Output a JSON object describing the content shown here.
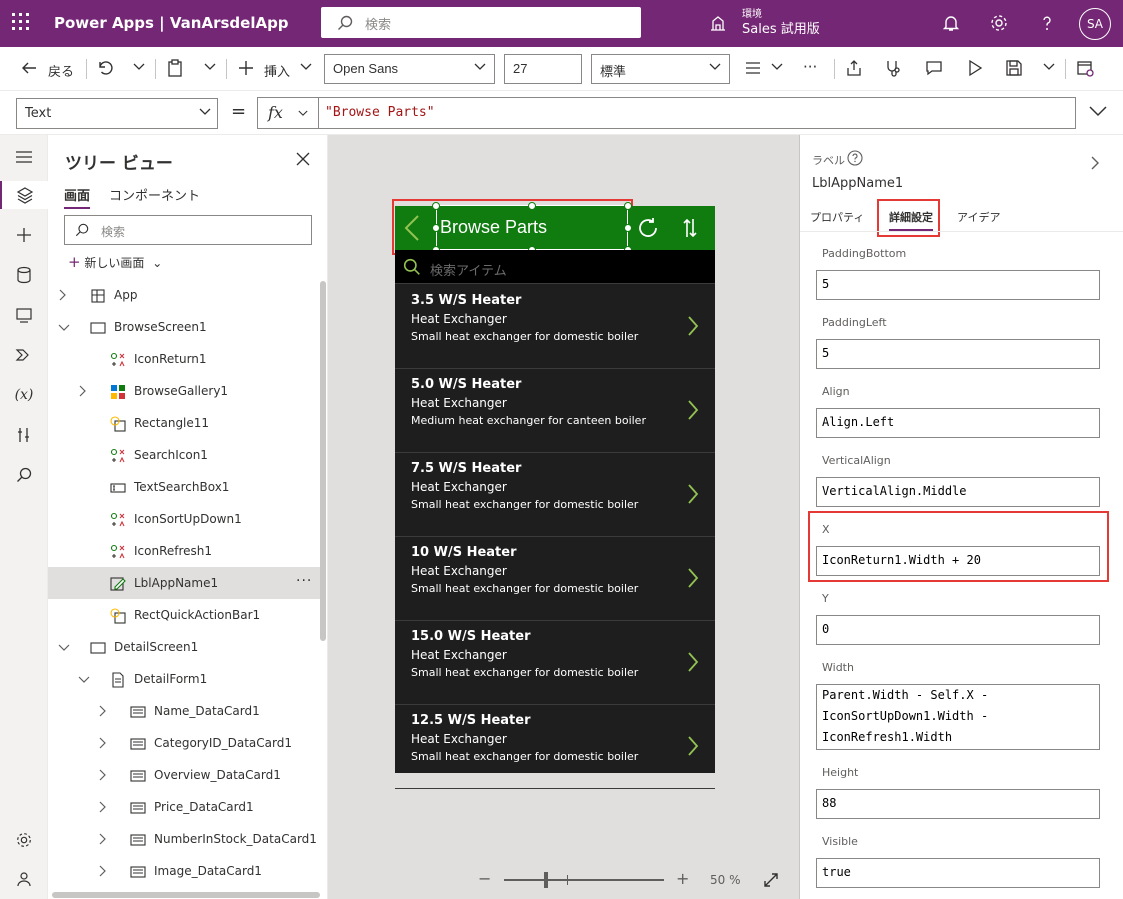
{
  "header": {
    "brand": "Power Apps | VanArsdelApp",
    "search_placeholder": "検索",
    "env_label": "環境",
    "env_name": "Sales 試用版",
    "avatar": "SA"
  },
  "command_bar": {
    "back": "戻る",
    "insert": "挿入",
    "font": "Open Sans",
    "font_size": "27",
    "font_weight": "標準",
    "more": "···"
  },
  "formula_bar": {
    "property": "Text",
    "equals": "=",
    "fx": "fx",
    "formula": "\"Browse Parts\""
  },
  "tree": {
    "title": "ツリー ビュー",
    "tabs": [
      "画面",
      "コンポーネント"
    ],
    "search_placeholder": "検索",
    "new_screen": "新しい画面",
    "rows": [
      {
        "label": "App",
        "indent": 0,
        "icon": "app-icon",
        "chevron": "right",
        "selected": false
      },
      {
        "label": "BrowseScreen1",
        "indent": 0,
        "icon": "screen-icon",
        "chevron": "down",
        "selected": false
      },
      {
        "label": "IconReturn1",
        "indent": 1,
        "icon": "icon-control-icon",
        "chevron": "",
        "selected": false
      },
      {
        "label": "BrowseGallery1",
        "indent": 1,
        "icon": "gallery-icon",
        "chevron": "right",
        "selected": false
      },
      {
        "label": "Rectangle11",
        "indent": 1,
        "icon": "shape-icon",
        "chevron": "",
        "selected": false
      },
      {
        "label": "SearchIcon1",
        "indent": 1,
        "icon": "icon-control-icon",
        "chevron": "",
        "selected": false
      },
      {
        "label": "TextSearchBox1",
        "indent": 1,
        "icon": "textinput-icon",
        "chevron": "",
        "selected": false
      },
      {
        "label": "IconSortUpDown1",
        "indent": 1,
        "icon": "icon-control-icon",
        "chevron": "",
        "selected": false
      },
      {
        "label": "IconRefresh1",
        "indent": 1,
        "icon": "icon-control-icon",
        "chevron": "",
        "selected": false
      },
      {
        "label": "LblAppName1",
        "indent": 1,
        "icon": "label-icon",
        "chevron": "",
        "selected": true
      },
      {
        "label": "RectQuickActionBar1",
        "indent": 1,
        "icon": "shape-icon",
        "chevron": "",
        "selected": false
      },
      {
        "label": "DetailScreen1",
        "indent": 0,
        "icon": "screen-icon",
        "chevron": "down",
        "selected": false
      },
      {
        "label": "DetailForm1",
        "indent": 1,
        "icon": "form-icon",
        "chevron": "down",
        "selected": false
      },
      {
        "label": "Name_DataCard1",
        "indent": 2,
        "icon": "datacard-icon",
        "chevron": "right",
        "selected": false
      },
      {
        "label": "CategoryID_DataCard1",
        "indent": 2,
        "icon": "datacard-icon",
        "chevron": "right",
        "selected": false
      },
      {
        "label": "Overview_DataCard1",
        "indent": 2,
        "icon": "datacard-icon",
        "chevron": "right",
        "selected": false
      },
      {
        "label": "Price_DataCard1",
        "indent": 2,
        "icon": "datacard-icon",
        "chevron": "right",
        "selected": false
      },
      {
        "label": "NumberInStock_DataCard1",
        "indent": 2,
        "icon": "datacard-icon",
        "chevron": "right",
        "selected": false
      },
      {
        "label": "Image_DataCard1",
        "indent": 2,
        "icon": "datacard-icon",
        "chevron": "right",
        "selected": false
      }
    ],
    "more": "···"
  },
  "app": {
    "title": "Browse Parts",
    "search_placeholder": "検索アイテム",
    "items": [
      {
        "title": "3.5 W/S Heater",
        "subtitle": "Heat Exchanger",
        "desc": "Small heat exchanger for domestic boiler"
      },
      {
        "title": "5.0 W/S Heater",
        "subtitle": "Heat Exchanger",
        "desc": "Medium heat exchanger for canteen boiler"
      },
      {
        "title": "7.5 W/S Heater",
        "subtitle": "Heat Exchanger",
        "desc": "Small heat exchanger for domestic boiler"
      },
      {
        "title": "10 W/S Heater",
        "subtitle": "Heat Exchanger",
        "desc": "Small heat exchanger for domestic boiler"
      },
      {
        "title": "15.0 W/S Heater",
        "subtitle": "Heat Exchanger",
        "desc": "Small heat exchanger for domestic boiler"
      },
      {
        "title": "12.5 W/S Heater",
        "subtitle": "Heat Exchanger",
        "desc": "Small heat exchanger for domestic boiler"
      }
    ]
  },
  "zoom": {
    "minus": "−",
    "plus": "+",
    "value": "50  %",
    "level_percent": 50
  },
  "props": {
    "control_type": "ラベル",
    "control_name": "LblAppName1",
    "tabs": [
      "プロパティ",
      "詳細設定",
      "アイデア"
    ],
    "fields": [
      {
        "label": "PaddingBottom",
        "value": "5"
      },
      {
        "label": "PaddingLeft",
        "value": "5"
      },
      {
        "label": "Align",
        "value": "Align.Left"
      },
      {
        "label": "VerticalAlign",
        "value": "VerticalAlign.Middle"
      },
      {
        "label": "X",
        "value": "IconReturn1.Width + 20"
      },
      {
        "label": "Y",
        "value": "0"
      },
      {
        "label": "Width",
        "value": "Parent.Width - Self.X -\nIconSortUpDown1.Width -\nIconRefresh1.Width"
      },
      {
        "label": "Height",
        "value": "88"
      },
      {
        "label": "Visible",
        "value": "true"
      }
    ]
  },
  "colors": {
    "brand": "#742774",
    "app_bar": "#107c10",
    "accent_green": "#92c353",
    "highlight": "#e53935"
  }
}
